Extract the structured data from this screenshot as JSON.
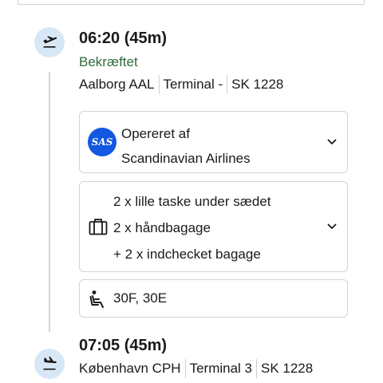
{
  "departure": {
    "time": "06:20 (45m)",
    "status": "Bekræftet",
    "airport": "Aalborg AAL",
    "terminal": "Terminal -",
    "flight": "SK 1228",
    "icon": "takeoff-icon"
  },
  "airline_card": {
    "operated_label": "Opereret af",
    "airline_name": "Scandinavian Airlines",
    "logo_text": "SAS",
    "logo_color": "#1258e0"
  },
  "baggage_card": {
    "lines": [
      "2 x lille taske under sædet",
      "2 x håndbagage",
      "+ 2 x indchecket bagage"
    ],
    "icon": "luggage-icon"
  },
  "seats_card": {
    "seats": "30F, 30E",
    "icon": "seat-icon"
  },
  "arrival": {
    "time": "07:05 (45m)",
    "airport": "København CPH",
    "terminal": "Terminal 3",
    "flight": "SK 1228",
    "icon": "landing-icon"
  },
  "colors": {
    "status_green": "#2e6b3a",
    "icon_circle_bg": "#d8e7f5",
    "border": "#d3d3d3"
  }
}
